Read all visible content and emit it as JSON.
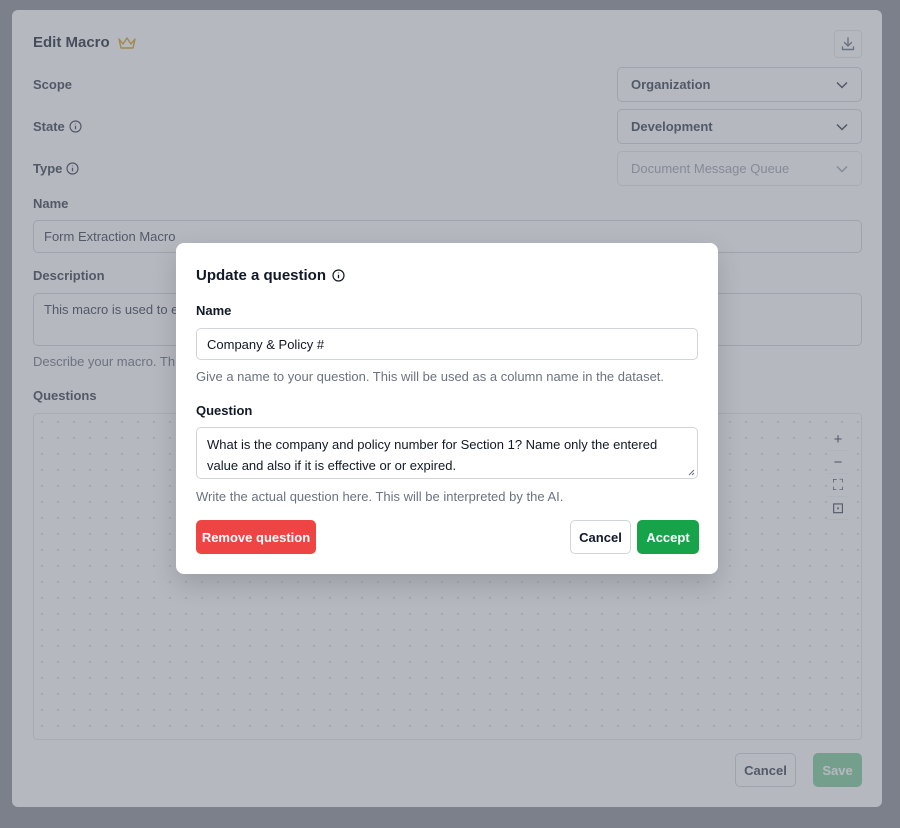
{
  "page": {
    "title": "Edit Macro",
    "scope_label": "Scope",
    "scope_value": "Organization",
    "state_label": "State",
    "state_value": "Development",
    "type_label": "Type",
    "type_value": "Document Message Queue",
    "name_label": "Name",
    "name_value": "Form Extraction Macro",
    "description_label": "Description",
    "description_value": "This macro is used to e",
    "description_helper": "Describe your macro. Thi",
    "questions_label": "Questions",
    "cancel_label": "Cancel",
    "save_label": "Save"
  },
  "canvas_controls": [
    "+",
    "−",
    "⛶",
    "⊡"
  ],
  "modal": {
    "title": "Update a question",
    "name_label": "Name",
    "name_value": "Company & Policy #",
    "name_helper": "Give a name to your question. This will be used as a column name in the dataset.",
    "question_label": "Question",
    "question_value": "What is the company and policy number for Section 1? Name only the entered value and also if it is effective or or expired.",
    "question_helper": "Write the actual question here. This will be interpreted by the AI.",
    "remove_label": "Remove question",
    "cancel_label": "Cancel",
    "accept_label": "Accept"
  },
  "colors": {
    "accept": "#16a34a",
    "remove": "#ef4444",
    "crown": "#d4a017"
  }
}
